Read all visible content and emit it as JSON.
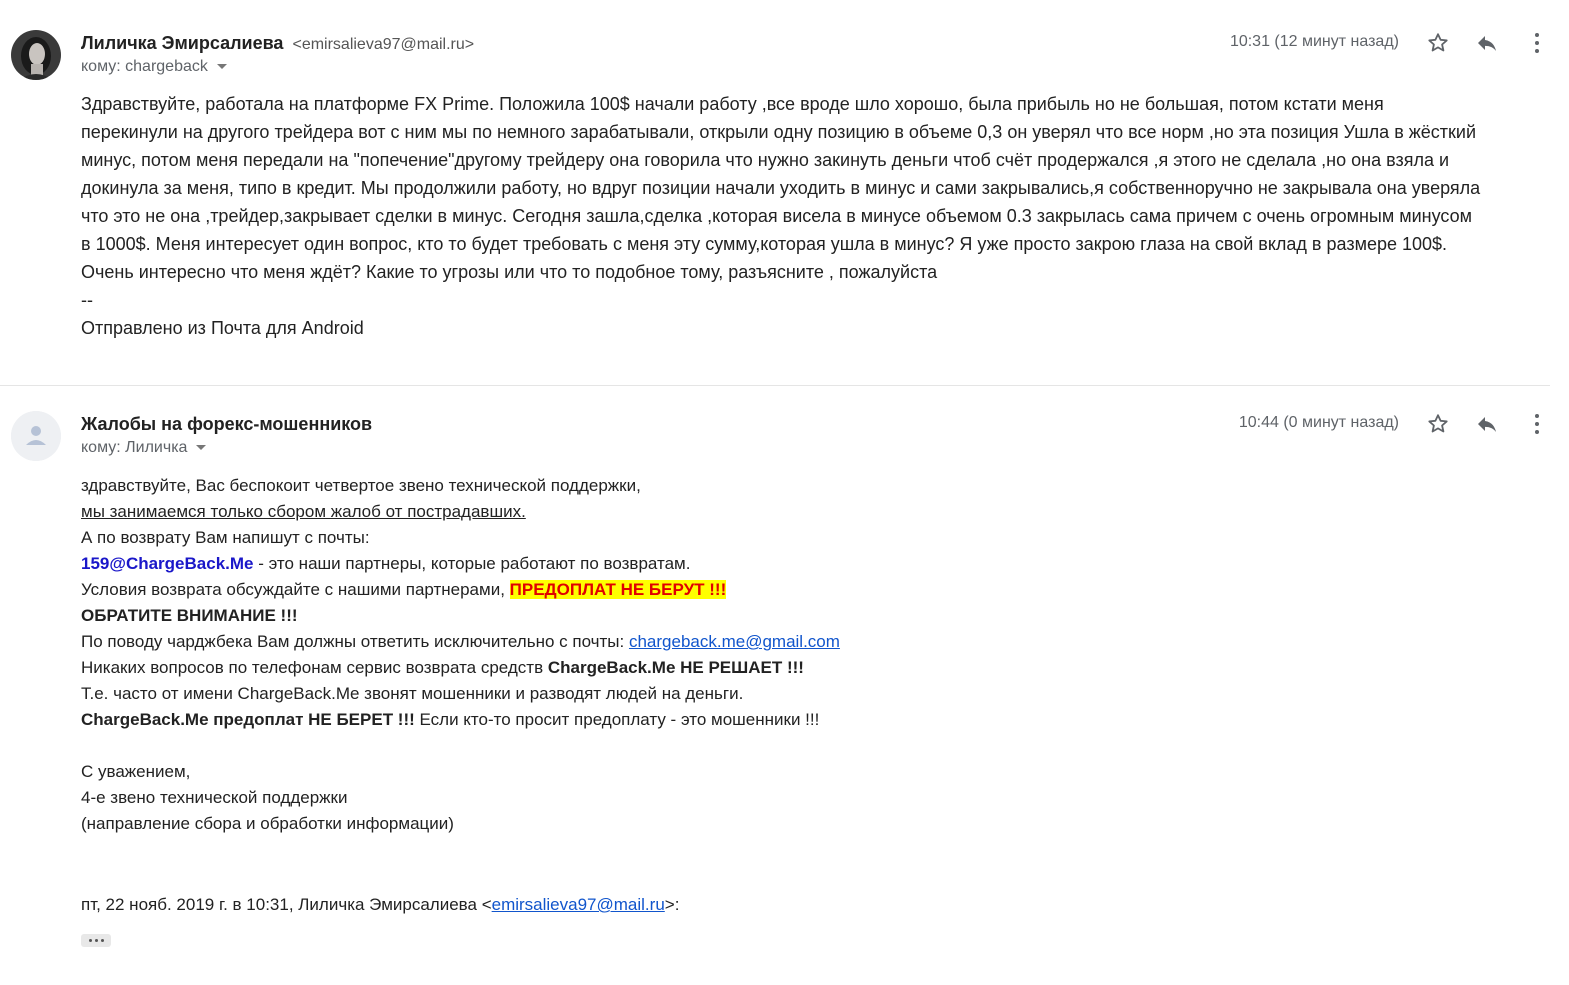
{
  "message1": {
    "sender_name": "Лиличка Эмирсалиева",
    "sender_email": "<emirsalieva97@mail.ru>",
    "to": "кому: chargeback",
    "time": "10:31 (12 минут назад)",
    "body_lines": [
      "Здравствуйте, работала на платформе FX Prime. Положила 100$ начали работу ,все вроде шло хорошо, была прибыль но не большая, потом кстати меня",
      "перекинули на другого трейдера вот с ним мы по немного зарабатывали, открыли одну позицию в объеме 0,3 он уверял что все норм ,но эта позиция Ушла в жёсткий",
      "минус, потом меня передали на \"попечение\"другому трейдеру она говорила что нужно закинуть деньги чтоб счёт продержался ,я этого не сделала ,но она взяла и",
      "докинула за меня, типо в кредит. Мы продолжили работу, но вдруг позиции начали уходить в минус и сами закрывались,я собственноручно не закрывала она уверяла",
      "что это не она ,трейдер,закрывает сделки в минус. Сегодня зашла,сделка ,которая висела в минусе объемом 0.3 закрылась сама причем с очень огромным минусом",
      "в 1000$. Меня интересует один вопрос, кто то будет требовать с меня эту сумму,которая ушла в минус? Я уже просто закрою глаза на свой вклад в размере 100$.",
      "Очень интересно что меня ждёт? Какие то угрозы или что то подобное тому, разъясните , пожалуйста",
      "--",
      "Отправлено из Почта для Android"
    ]
  },
  "message2": {
    "sender_name": "Жалобы на форекс-мошенников",
    "to": "кому: Лиличка",
    "time": "10:44 (0 минут назад)",
    "line1": "здравствуйте, Вас беспокоит четвертое звено технической поддержки,",
    "line2": "мы занимаемся только сбором жалоб от пострадавших.",
    "line3": "А по возврату Вам напишут с почты:",
    "line4_email": "159@ChargeBack.Me",
    "line4_rest": " - это наши партнеры, которые работают по возвратам.",
    "line5_text": "Условия возврата обсуждайте с нашими партнерами, ",
    "line5_warn": "ПРЕДОПЛАТ НЕ БЕРУТ !!!",
    "line6": "ОБРАТИТЕ ВНИМАНИЕ !!!",
    "line7_text": "По поводу чарджбека Вам должны ответить исключительно с почты: ",
    "line7_link": "chargeback.me@gmail.com",
    "line8_text": "Никаких вопросов по телефонам сервис возврата средств ",
    "line8_bold": "ChargeBack.Me НЕ РЕШАЕТ !!!",
    "line9": "Т.е. часто от имени ChargeBack.Me звонят мошенники и разводят людей на деньги.",
    "line10_bold": "ChargeBack.Me предоплат НЕ БЕРЕТ !!!",
    "line10_rest": " Если кто-то просит предоплату - это мошенники !!!",
    "sign1": "С уважением,",
    "sign2": "4-е звено технической поддержки",
    "sign3": "(направление сбора и обработки информации)",
    "quote_prefix": "пт, 22 нояб. 2019 г. в 10:31, Лиличка Эмирсалиева <",
    "quote_email": "emirsalieva97@mail.ru",
    "quote_suffix": ">:"
  },
  "icons": [
    "star-icon",
    "reply-icon",
    "more-vert-icon",
    "avatar-placeholder-icon"
  ],
  "colors": {
    "warn_text": "#e00000",
    "warn_bg": "#ffff00",
    "link": "#1155cc",
    "partner_email": "#1a17c9"
  }
}
